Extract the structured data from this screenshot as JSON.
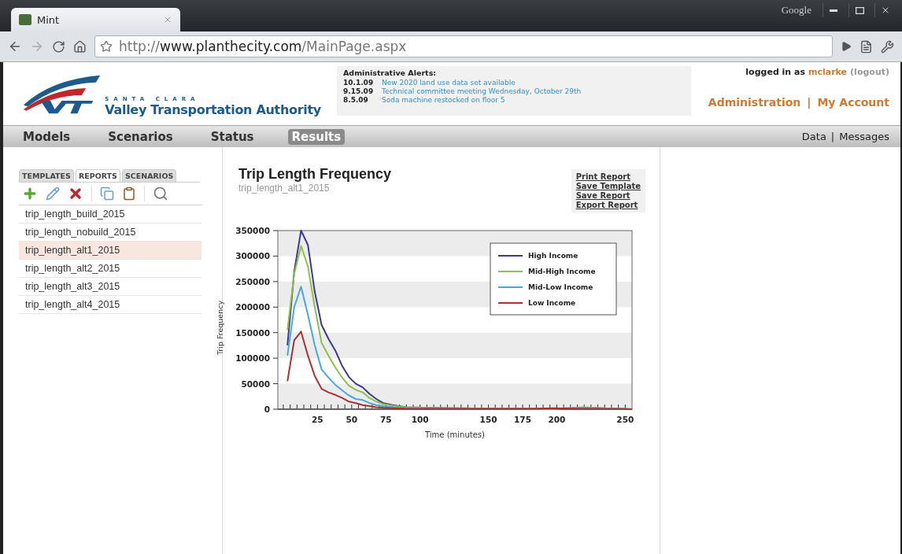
{
  "browser": {
    "tab_title": "Mint",
    "search_label": "Google",
    "url": {
      "scheme": "http://",
      "host": "www.planthecity.com",
      "path": "/MainPage.aspx"
    }
  },
  "header": {
    "logo": {
      "region": "SANTA CLARA",
      "name": "Valley Transportation Authority"
    },
    "alerts": {
      "title": "Administrative Alerts:",
      "items": [
        {
          "date": "10.1.09",
          "text": "New 2020 land use data set available"
        },
        {
          "date": "9.15.09",
          "text": "Technical committee meeting Wednesday, October 29th"
        },
        {
          "date": "8.5.09",
          "text": "Soda machine restocked on floor 5"
        }
      ]
    },
    "login": {
      "prefix": "logged in as",
      "user": "mclarke",
      "logout": "(logout)"
    },
    "account_links": [
      "Administration",
      "|",
      "My Account"
    ]
  },
  "nav": {
    "items": [
      {
        "label": "Models",
        "selected": false
      },
      {
        "label": "Scenarios",
        "selected": false
      },
      {
        "label": "Status",
        "selected": false
      },
      {
        "label": "Results",
        "selected": true
      }
    ],
    "right_links": [
      "Data",
      "|",
      "Messages"
    ]
  },
  "sidebar": {
    "tabs": [
      {
        "label": "TEMPLATES",
        "selected": false
      },
      {
        "label": "REPORTS",
        "selected": true
      },
      {
        "label": "SCENARIOS",
        "selected": false
      }
    ],
    "items": [
      {
        "label": "trip_length_build_2015",
        "selected": false
      },
      {
        "label": "trip_length_nobuild_2015",
        "selected": false
      },
      {
        "label": "trip_length_alt1_2015",
        "selected": true
      },
      {
        "label": "trip_length_alt2_2015",
        "selected": false
      },
      {
        "label": "trip_length_alt3_2015",
        "selected": false
      },
      {
        "label": "trip_length_alt4_2015",
        "selected": false
      }
    ]
  },
  "report": {
    "title": "Trip Length Frequency",
    "subtitle": "trip_length_alt1_2015",
    "actions": [
      "Print Report",
      "Save Template",
      "Save Report",
      "Export Report"
    ],
    "chart_data": {
      "type": "line",
      "xlabel": "Time (minutes)",
      "ylabel": "Trip Frequency",
      "x": [
        3,
        8,
        13,
        18,
        23,
        28,
        33,
        38,
        43,
        48,
        53,
        58,
        63,
        68,
        73,
        80,
        90,
        120,
        180,
        198,
        220,
        232,
        255
      ],
      "series": [
        {
          "name": "High Income",
          "color": "#3d3a8c",
          "values": [
            125000,
            270000,
            350000,
            322000,
            230000,
            165000,
            138000,
            115000,
            85000,
            63000,
            50000,
            43000,
            30000,
            20000,
            12000,
            8000,
            4000,
            2000,
            1000,
            1000,
            2000,
            2000,
            0
          ]
        },
        {
          "name": "Mid-High Income",
          "color": "#8cc04a",
          "values": [
            155000,
            265000,
            320000,
            280000,
            200000,
            130000,
            105000,
            82000,
            62000,
            46000,
            38000,
            33000,
            22000,
            15000,
            10000,
            7000,
            4000,
            2000,
            1000,
            1000,
            4000,
            2000,
            0
          ]
        },
        {
          "name": "Mid-Low Income",
          "color": "#4aa8d8",
          "values": [
            105000,
            200000,
            240000,
            185000,
            125000,
            78000,
            62000,
            48000,
            37000,
            27000,
            20000,
            18000,
            12000,
            8000,
            6000,
            4000,
            3000,
            2000,
            1000,
            1000,
            3000,
            2000,
            0
          ]
        },
        {
          "name": "Low Income",
          "color": "#a83232",
          "values": [
            55000,
            135000,
            152000,
            105000,
            65000,
            40000,
            33000,
            28000,
            22000,
            15000,
            12000,
            8000,
            6000,
            4000,
            3000,
            2000,
            1000,
            1000,
            1000,
            2000,
            1000,
            1000,
            0
          ]
        }
      ],
      "legend": true,
      "xlim": [
        -4,
        255
      ],
      "ylim": [
        0,
        350000
      ],
      "xticks": [
        25,
        50,
        75,
        100,
        150,
        175,
        200,
        250
      ],
      "yticks": [
        0,
        50000,
        100000,
        150000,
        200000,
        250000,
        300000,
        350000
      ]
    }
  }
}
